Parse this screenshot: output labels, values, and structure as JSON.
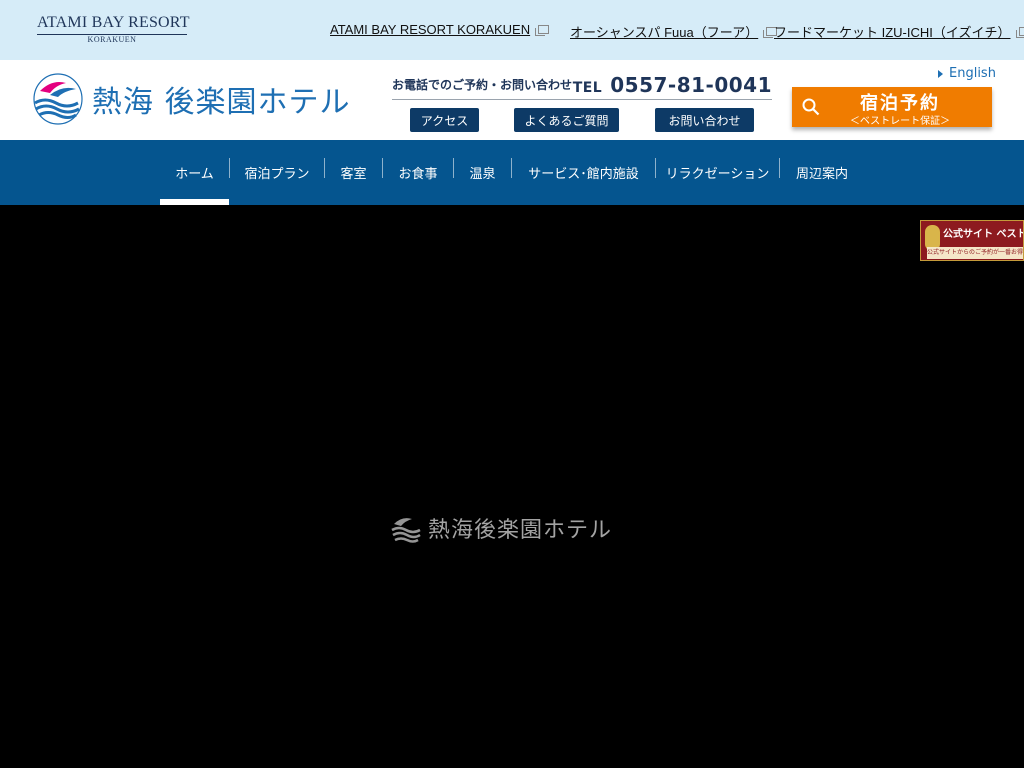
{
  "topbar": {
    "brand_line1": "ATAMI BAY RESORT",
    "brand_line2": "KORAKUEN",
    "links": [
      {
        "label": "ATAMI BAY RESORT KORAKUEN"
      },
      {
        "label": "オーシャンスパ Fuua（フーア）"
      },
      {
        "label": "フードマーケット IZU-ICHI（イズイチ）"
      }
    ]
  },
  "header": {
    "logo_text": "熱海 後楽園ホテル",
    "tel_label": "お電話でのご予約・お問い合わせ",
    "tel_prefix": "TEL",
    "tel_number": "0557-81-0041",
    "buttons": [
      {
        "label": "アクセス"
      },
      {
        "label": "よくあるご質問"
      },
      {
        "label": "お問い合わせ"
      }
    ],
    "language_link": "English",
    "reserve_main": "宿泊予約",
    "reserve_sub": "＜ベストレート保証＞"
  },
  "nav": {
    "items": [
      {
        "label": "ホーム",
        "active": true
      },
      {
        "label": "宿泊プラン"
      },
      {
        "label": "客室"
      },
      {
        "label": "お食事"
      },
      {
        "label": "温泉"
      },
      {
        "label": "サービス･館内施設"
      },
      {
        "label": "リラクゼーション"
      },
      {
        "label": "周辺案内"
      }
    ]
  },
  "hero": {
    "logo_text": "熱海後楽園ホテル"
  },
  "badge": {
    "main": "公式サイト ベストレート保証",
    "sub": "公式サイトからのご予約が一番お得です"
  },
  "colors": {
    "topbar_bg": "#d6ecf8",
    "nav_bg": "#05558f",
    "reserve_bg": "#f07c00",
    "button_bg": "#0d3a66"
  }
}
